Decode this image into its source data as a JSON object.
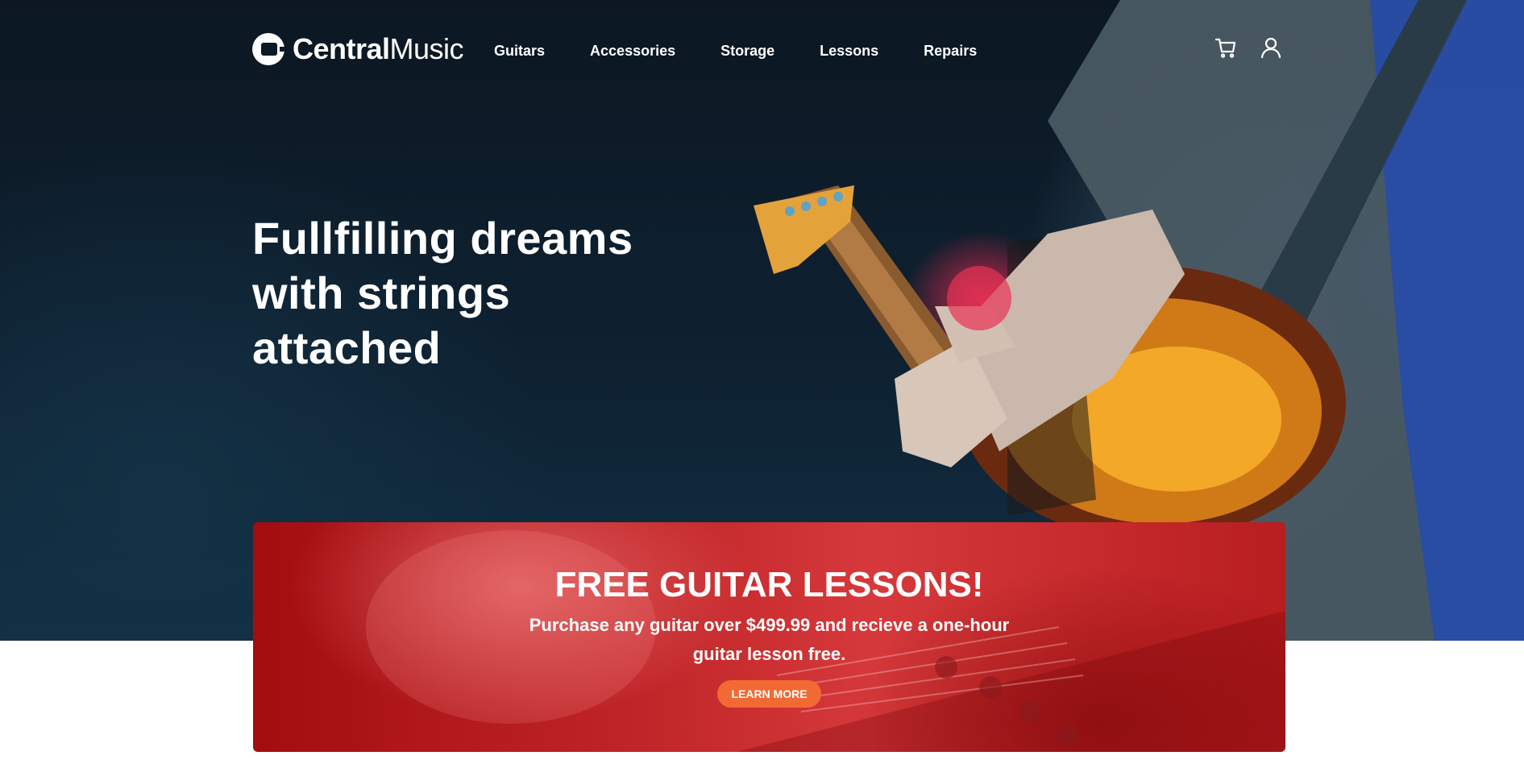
{
  "brand": {
    "name_bold": "Central",
    "name_regular": "Music",
    "logo_icon": "guitar-amp-logo-icon"
  },
  "nav": {
    "items": [
      {
        "label": "Guitars"
      },
      {
        "label": "Accessories"
      },
      {
        "label": "Storage"
      },
      {
        "label": "Lessons"
      },
      {
        "label": "Repairs"
      }
    ],
    "icons": [
      "cart-icon",
      "user-icon"
    ]
  },
  "hero": {
    "headline": "Fullfilling dreams with strings attached"
  },
  "promo": {
    "title": "FREE GUITAR LESSONS!",
    "body": "Purchase any guitar over $499.99 and recieve a one-hour guitar lesson free.",
    "button_label": "LEARN MORE"
  },
  "colors": {
    "promo_red": "#c2272a",
    "button_orange": "#f26a33",
    "hero_dark": "#0c1722",
    "text": "#ffffff"
  }
}
